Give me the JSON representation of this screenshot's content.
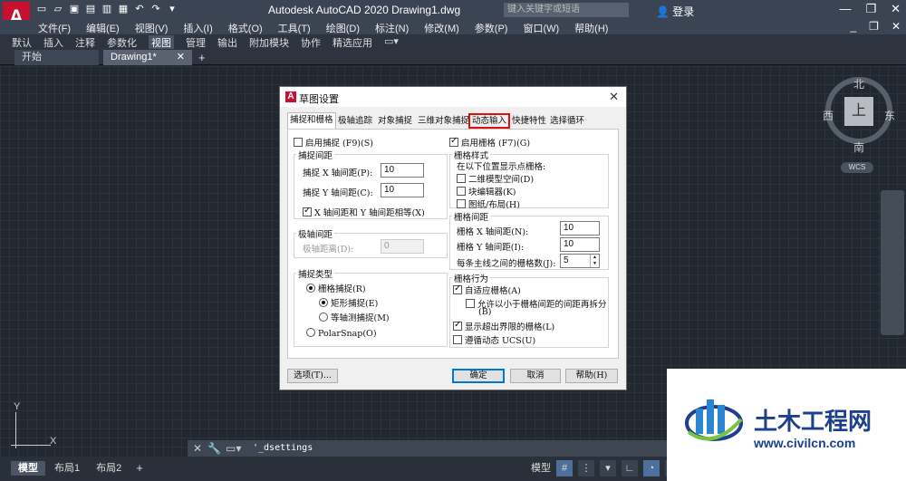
{
  "app": {
    "logo": "A",
    "title": "Autodesk AutoCAD 2020    Drawing1.dwg",
    "search_placeholder": "键入关键字或短语",
    "login": "登录"
  },
  "menu": [
    "文件(F)",
    "编辑(E)",
    "视图(V)",
    "插入(I)",
    "格式(O)",
    "工具(T)",
    "绘图(D)",
    "标注(N)",
    "修改(M)",
    "参数(P)",
    "窗口(W)",
    "帮助(H)"
  ],
  "ribbon_tabs": [
    "默认",
    "插入",
    "注释",
    "参数化",
    "视图",
    "管理",
    "输出",
    "附加模块",
    "协作",
    "精选应用"
  ],
  "ribbon_active": "视图",
  "doc_tabs": [
    "开始",
    "Drawing1*"
  ],
  "viewcube": {
    "north": "北",
    "south": "南",
    "east": "东",
    "west": "西",
    "top": "上",
    "wcs": "WCS"
  },
  "ucs": {
    "x": "X",
    "y": "Y"
  },
  "command": {
    "text": "'_dsettings"
  },
  "layout_tabs": [
    "模型",
    "布局1",
    "布局2"
  ],
  "status": {
    "model": "模型"
  },
  "dialog": {
    "title": "草图设置",
    "tabs": [
      "捕捉和栅格",
      "极轴追踪",
      "对象捕捉",
      "三维对象捕捉",
      "动态输入",
      "快捷特性",
      "选择循环"
    ],
    "active_tab": "捕捉和栅格",
    "highlighted_tab": "动态输入",
    "snap_on": "启用捕捉 (F9)(S)",
    "snap_spacing": {
      "label": "捕捉间距",
      "x_label": "捕捉 X 轴间距(P):",
      "x_value": "10",
      "y_label": "捕捉 Y 轴间距(C):",
      "y_value": "10",
      "equal": "X 轴间距和 Y 轴间距相等(X)"
    },
    "polar_spacing": {
      "label": "极轴间距",
      "distance_label": "极轴距离(D):",
      "distance_value": "0"
    },
    "snap_type": {
      "label": "捕捉类型",
      "grid_snap": "栅格捕捉(R)",
      "rect_snap": "矩形捕捉(E)",
      "iso_snap": "等轴测捕捉(M)",
      "polarsnap": "PolarSnap(O)"
    },
    "grid_on": "启用栅格 (F7)(G)",
    "grid_style": {
      "label": "栅格样式",
      "desc": "在以下位置显示点栅格:",
      "model": "二维模型空间(D)",
      "block": "块编辑器(K)",
      "sheet": "图纸/布局(H)"
    },
    "grid_spacing": {
      "label": "栅格间距",
      "x_label": "栅格 X 轴间距(N):",
      "x_value": "10",
      "y_label": "栅格 Y 轴间距(I):",
      "y_value": "10",
      "major_label": "每条主线之间的栅格数(J):",
      "major_value": "5"
    },
    "grid_behavior": {
      "label": "栅格行为",
      "adaptive": "自适应栅格(A)",
      "subdivide": "允许以小于栅格间距的间距再拆分",
      "subdivide2": "(B)",
      "beyond": "显示超出界限的栅格(L)",
      "follow": "遵循动态 UCS(U)"
    },
    "buttons": {
      "options": "选项(T)...",
      "ok": "确定",
      "cancel": "取消",
      "help": "帮助(H)"
    }
  },
  "watermark": {
    "title": "土木工程网",
    "url": "www.civilcn.com"
  }
}
